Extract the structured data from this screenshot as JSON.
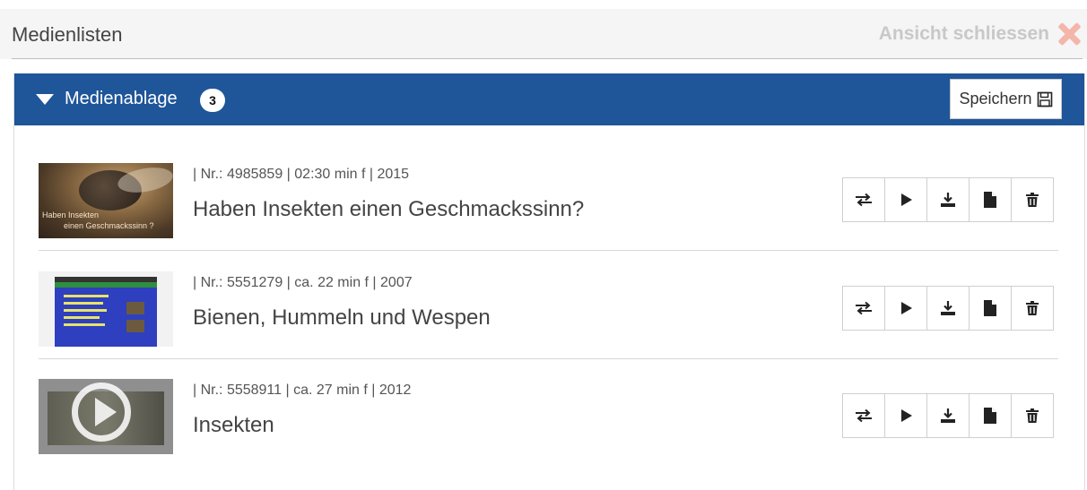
{
  "header": {
    "title": "Medienlisten",
    "close_label": "Ansicht schliessen"
  },
  "panel": {
    "title": "Medienablage",
    "count": "3",
    "save_label": "Speichern"
  },
  "items": [
    {
      "meta": "| Nr.: 4985859 | 02:30 min f | 2015",
      "title": "Haben Insekten einen Geschmackssinn?",
      "thumb_caption_1": "Haben Insekten",
      "thumb_caption_2": "einen Geschmackssinn ?"
    },
    {
      "meta": "| Nr.: 5551279 | ca. 22 min f | 2007",
      "title": "Bienen, Hummeln und Wespen"
    },
    {
      "meta": "| Nr.: 5558911 | ca. 27 min f | 2012",
      "title": "Insekten"
    }
  ],
  "action_icons": [
    "transfer-icon",
    "play-icon",
    "download-icon",
    "document-icon",
    "trash-icon"
  ],
  "colors": {
    "bar": "#1f5599",
    "close_icon": "#f4b5aa",
    "close_text": "#c8c8c8"
  }
}
